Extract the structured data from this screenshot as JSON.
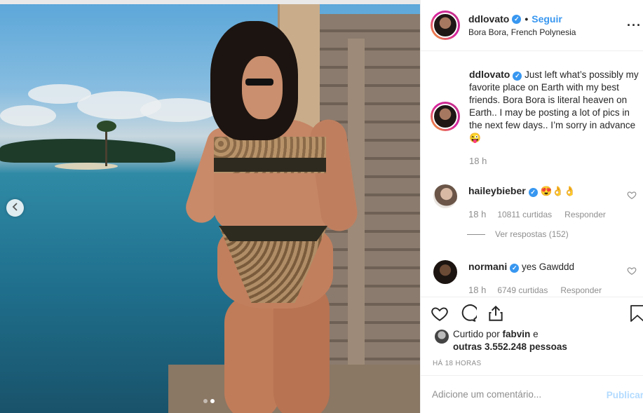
{
  "post": {
    "username": "ddlovato",
    "follow_label": "Seguir",
    "location": "Bora Bora, French Polynesia",
    "more_label": "···",
    "verified_mark": "✓",
    "separator": "•"
  },
  "caption": {
    "username": "ddlovato",
    "text": "Just left what’s possibly my favorite place on Earth with my best friends. Bora Bora is literal heaven on Earth.. I may be posting a lot of pics in the next few days.. I’m sorry in advance 😜",
    "time": "18 h"
  },
  "comments": [
    {
      "username": "haileybieber",
      "text": "😍👌👌",
      "time": "18 h",
      "likes": "10811 curtidas",
      "reply_label": "Responder"
    },
    {
      "username": "normani",
      "text": "yes Gawddd",
      "time": "18 h",
      "likes": "6749 curtidas",
      "reply_label": "Responder"
    }
  ],
  "view_replies": "Ver respostas (152)",
  "likes_summary": {
    "prefix": "Curtido por ",
    "user": "fabvin",
    "middle": " e",
    "others": "outras 3.552.248 pessoas"
  },
  "time_ago": "HÁ 18 HORAS",
  "add_comment": {
    "placeholder": "Adicione um comentário...",
    "publish_label": "Publicar"
  },
  "carousel": {
    "total_slides": 2,
    "active_slide": 2
  },
  "icons": {
    "nav_left": "chevron-left-icon",
    "like": "heart-icon",
    "comment": "comment-icon",
    "share": "share-icon",
    "save": "bookmark-icon"
  },
  "colors": {
    "accent": "#3897f0",
    "muted": "#8e8e8e",
    "publish_disabled": "#b3dbff"
  }
}
